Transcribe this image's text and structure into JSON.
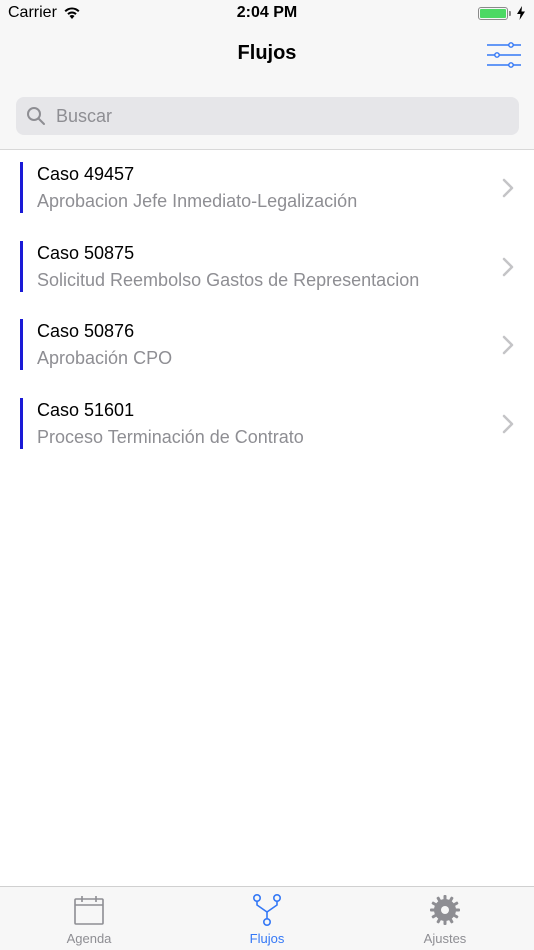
{
  "status_bar": {
    "carrier": "Carrier",
    "time": "2:04 PM"
  },
  "nav": {
    "title": "Flujos",
    "filter_icon": "filter-sliders-icon"
  },
  "search": {
    "placeholder": "Buscar",
    "value": ""
  },
  "cases": [
    {
      "title": "Caso 49457",
      "subtitle": "Aprobacion Jefe Inmediato-Legalización"
    },
    {
      "title": "Caso 50875",
      "subtitle": "Solicitud Reembolso Gastos de Representacion"
    },
    {
      "title": "Caso 50876",
      "subtitle": "Aprobación CPO"
    },
    {
      "title": "Caso 51601",
      "subtitle": "Proceso Terminación de Contrato"
    }
  ],
  "tabs": [
    {
      "label": "Agenda",
      "icon": "calendar-icon",
      "active": false
    },
    {
      "label": "Flujos",
      "icon": "flow-branch-icon",
      "active": true
    },
    {
      "label": "Ajustes",
      "icon": "gear-icon",
      "active": false
    }
  ],
  "colors": {
    "accent": "#1a1ad6",
    "tint": "#3478f6",
    "battery": "#4cd964"
  }
}
